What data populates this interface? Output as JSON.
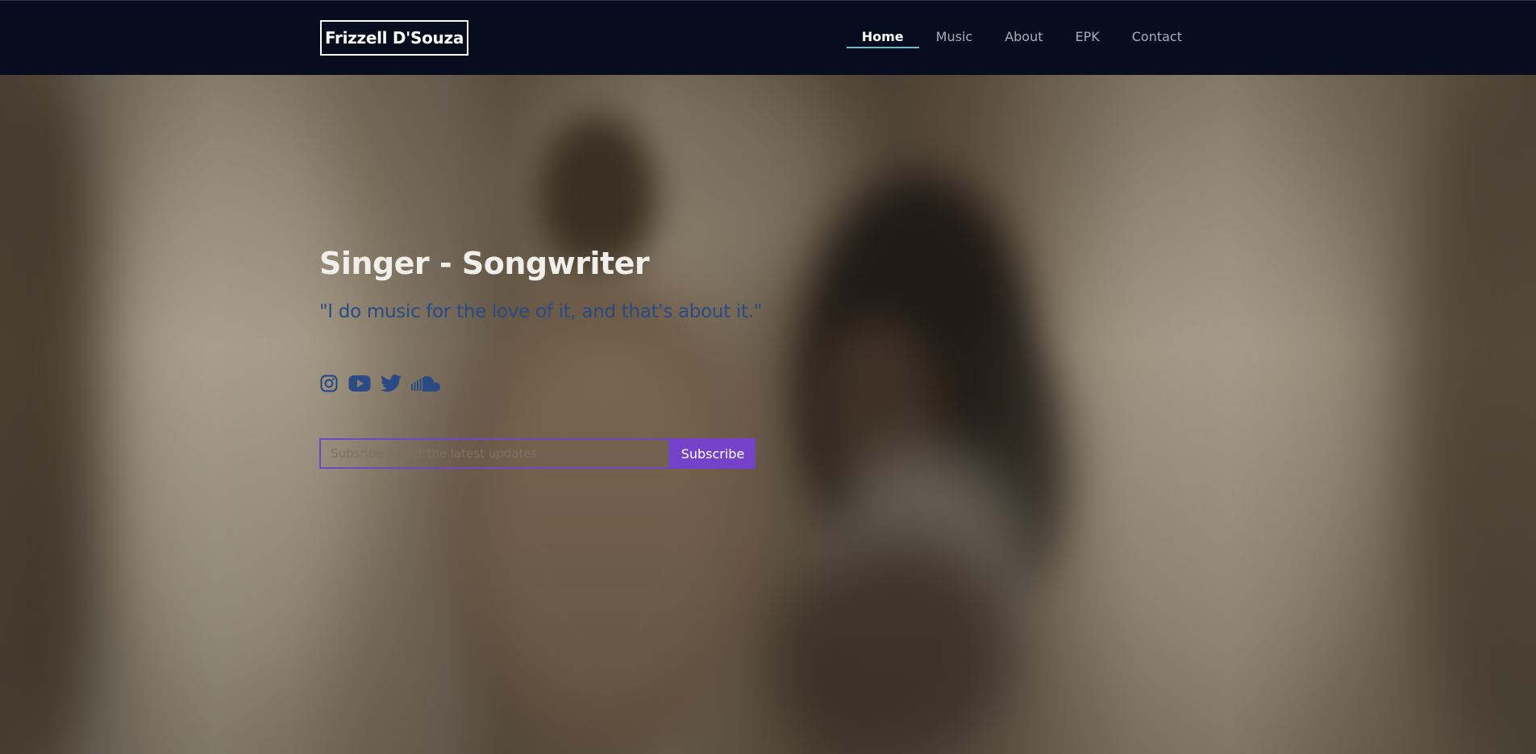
{
  "brand": {
    "name": "Frizzell D'Souza"
  },
  "nav": {
    "items": [
      {
        "label": "Home",
        "active": true
      },
      {
        "label": "Music",
        "active": false
      },
      {
        "label": "About",
        "active": false
      },
      {
        "label": "EPK",
        "active": false
      },
      {
        "label": "Contact",
        "active": false
      }
    ]
  },
  "hero": {
    "title": "Singer - Songwriter",
    "quote": "\"I do music for the love of it, and that's about it.\"",
    "socials": [
      {
        "icon": "instagram-icon"
      },
      {
        "icon": "youtube-icon"
      },
      {
        "icon": "twitter-icon"
      },
      {
        "icon": "soundcloud-icon"
      }
    ],
    "subscribe": {
      "placeholder": "Subsribe to get the latest updates",
      "button_label": "Subscribe"
    }
  },
  "colors": {
    "navbar_bg": "#070d1f",
    "accent_purple": "#7442c8",
    "nav_active_underline": "#6fb8c6",
    "quote_blue": "#2a4a86",
    "social_icon_blue": "#2a4a86"
  }
}
